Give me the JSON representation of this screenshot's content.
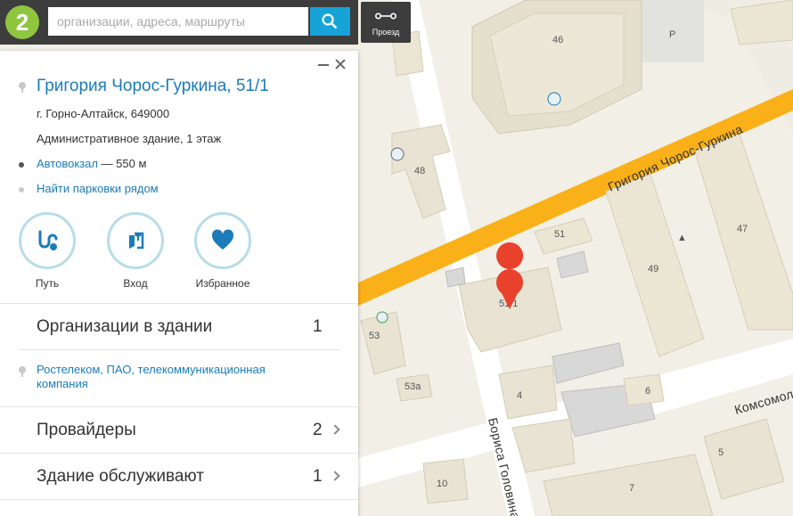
{
  "search": {
    "placeholder": "организации, адреса, маршруты",
    "logo_text": "2",
    "route_button_label": "Проезд",
    "search_icon": "magnifier-icon",
    "route_icon": "route-icon"
  },
  "card": {
    "title": "Григория Чорос-Гуркина, 51/1",
    "address": "г. Горно-Алтайск, 649000",
    "description": "Административное здание, 1 этаж",
    "stop": {
      "name": "Автовокзал",
      "distance": " — 550 м",
      "dot_color": "#555555"
    },
    "parking_link": "Найти парковки рядом",
    "actions": [
      {
        "label": "Путь",
        "icon": "route-path-icon"
      },
      {
        "label": "Вход",
        "icon": "entrance-icon"
      },
      {
        "label": "Избранное",
        "icon": "heart-icon"
      }
    ],
    "organizations": {
      "label": "Организации в здании",
      "count": "1"
    },
    "organization_item": "Ростелеком, ПАО, телекоммуникационная компания",
    "providers": {
      "label": "Провайдеры",
      "count": "2"
    },
    "service": {
      "label": "Здание обслуживают",
      "count": "1"
    }
  },
  "map": {
    "street_main": "Григория Чорос-Гуркина",
    "street_side": "Бориса Головина",
    "street_right": "Комсомольская",
    "building_labels": [
      "46",
      "48",
      "51",
      "51/1",
      "49",
      "47",
      "53",
      "53а",
      "4",
      "6",
      "5",
      "7",
      "10"
    ],
    "parking_letter": "P",
    "colors": {
      "road_main": "#fab119",
      "marker": "#e8412c",
      "accent": "#1c7bb8"
    }
  }
}
